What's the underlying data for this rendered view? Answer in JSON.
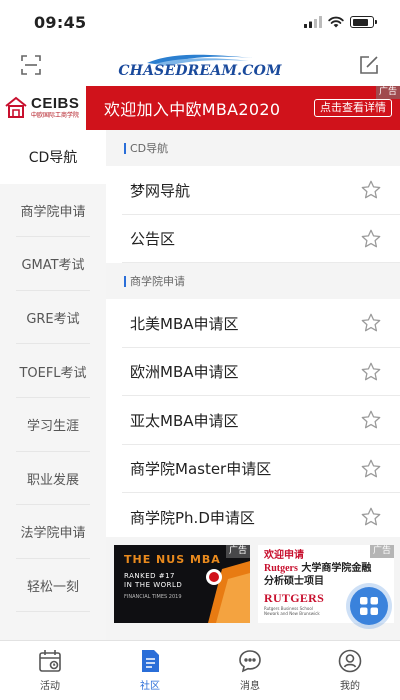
{
  "status_bar": {
    "time": "09:45"
  },
  "header": {
    "logo_text": "CHASEDREAM.COM",
    "left_icon": "scan-icon",
    "right_icon": "edit-icon"
  },
  "banner": {
    "brand": "CEIBS",
    "brand_sub": "中欧国际工商学院",
    "title": "欢迎加入中欧MBA2020",
    "button": "点击查看详情",
    "ad_tag": "广告"
  },
  "sidebar": {
    "items": [
      {
        "label": "CD导航",
        "active": true
      },
      {
        "label": "商学院申请",
        "active": false
      },
      {
        "label": "GMAT考试",
        "active": false
      },
      {
        "label": "GRE考试",
        "active": false
      },
      {
        "label": "TOEFL考试",
        "active": false
      },
      {
        "label": "学习生涯",
        "active": false
      },
      {
        "label": "职业发展",
        "active": false
      },
      {
        "label": "法学院申请",
        "active": false
      },
      {
        "label": "轻松一刻",
        "active": false
      }
    ]
  },
  "main": {
    "sections": [
      {
        "title": "CD导航",
        "rows": [
          "梦网导航",
          "公告区"
        ]
      },
      {
        "title": "商学院申请",
        "rows": [
          "北美MBA申请区",
          "欧洲MBA申请区",
          "亚太MBA申请区",
          "商学院Master申请区",
          "商学院Ph.D申请区"
        ]
      }
    ]
  },
  "ads": {
    "ad1": {
      "title": "THE NUS MBA",
      "rank_line1": "RANKED #17",
      "rank_line2": "IN THE WORLD",
      "source": "FINANCIAL TIMES 2019",
      "tag": "广告"
    },
    "ad2": {
      "line1": "欢迎申请",
      "line2_brand": "Rutgers",
      "line2_rest": " 大学商学院金融",
      "line3": "分析硕士项目",
      "logo": "RUTGERS",
      "sub1": "Rutgers Business School",
      "sub2": "Newark and New Brunswick",
      "tag": "广告"
    }
  },
  "tabbar": {
    "tabs": [
      {
        "label": "活动",
        "icon": "calendar-icon",
        "active": false
      },
      {
        "label": "社区",
        "icon": "document-icon",
        "active": true
      },
      {
        "label": "消息",
        "icon": "chat-icon",
        "active": false
      },
      {
        "label": "我的",
        "icon": "user-icon",
        "active": false
      }
    ]
  },
  "colors": {
    "brand_red": "#d0121b",
    "accent_blue": "#2a6ed8",
    "sidebar_bg": "#f5f5f5"
  }
}
